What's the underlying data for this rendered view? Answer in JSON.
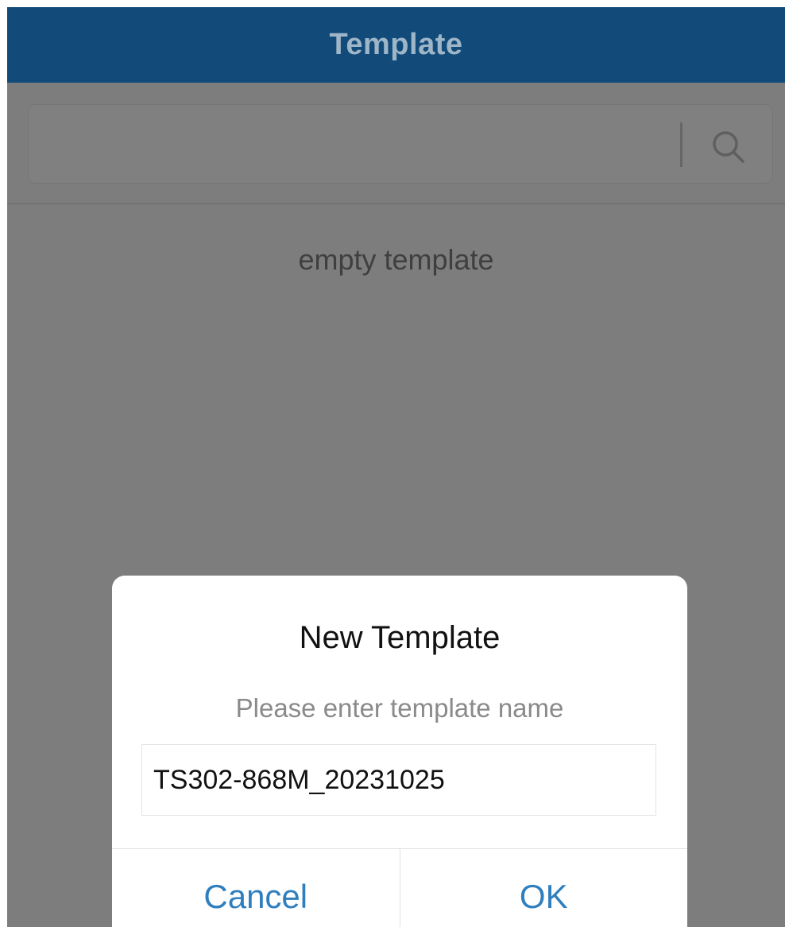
{
  "header": {
    "title": "Template"
  },
  "search": {
    "placeholder": "",
    "icon": "search-icon"
  },
  "list": {
    "empty_message": "empty template"
  },
  "dialog": {
    "title": "New Template",
    "hint": "Please enter template name",
    "input_value": "TS302-868M_20231025",
    "cancel_label": "Cancel",
    "ok_label": "OK"
  },
  "colors": {
    "header_bg": "#124b79",
    "overlay_bg": "#7d7d7d",
    "button_text": "#2f7fbf"
  }
}
